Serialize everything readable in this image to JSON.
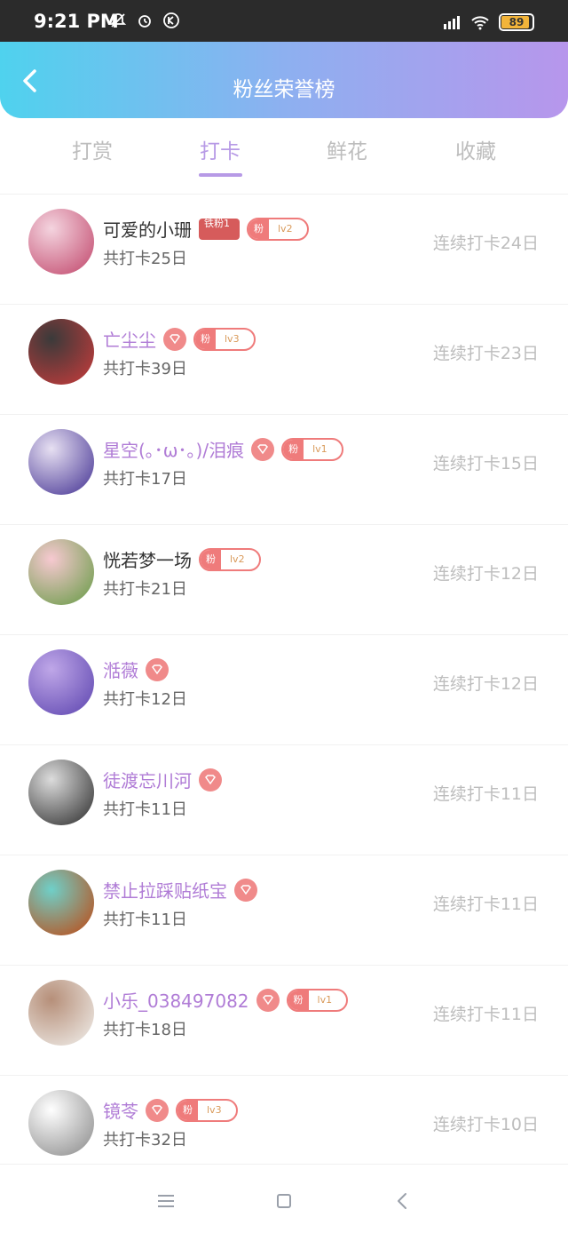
{
  "status": {
    "time": "9:21 PM",
    "battery": "89",
    "network_label": "HD"
  },
  "header": {
    "title": "粉丝荣誉榜"
  },
  "tabs": [
    {
      "label": "打赏",
      "active": false
    },
    {
      "label": "打卡",
      "active": true
    },
    {
      "label": "鲜花",
      "active": false
    },
    {
      "label": "收藏",
      "active": false
    }
  ],
  "rows": [
    {
      "name": "可爱的小珊",
      "name_vip": false,
      "tie_badge": "铁粉1",
      "fan_badge": {
        "left": "粉",
        "right": "lv2"
      },
      "diamond": false,
      "total": "共打卡25日",
      "streak": "连续打卡24日",
      "avatar_colors": [
        "#f4d4df",
        "#c85a7b"
      ]
    },
    {
      "name": "亡尘尘",
      "name_vip": true,
      "diamond": true,
      "fan_badge": {
        "left": "粉",
        "right": "lv3"
      },
      "total": "共打卡39日",
      "streak": "连续打卡23日",
      "avatar_colors": [
        "#3a3a3a",
        "#b63b3b"
      ]
    },
    {
      "name": "星空(｡･ω･｡)/泪痕",
      "name_vip": true,
      "diamond": true,
      "fan_badge": {
        "left": "粉",
        "right": "lv1"
      },
      "total": "共打卡17日",
      "streak": "连续打卡15日",
      "avatar_colors": [
        "#e7e0f2",
        "#5a4aa0"
      ]
    },
    {
      "name": "恍若梦一场",
      "name_vip": false,
      "diamond": false,
      "fan_badge": {
        "left": "粉",
        "right": "lv2"
      },
      "total": "共打卡21日",
      "streak": "连续打卡12日",
      "avatar_colors": [
        "#f7c9d1",
        "#79a157"
      ]
    },
    {
      "name": "湉薇",
      "name_vip": true,
      "diamond": true,
      "total": "共打卡12日",
      "streak": "连续打卡12日",
      "avatar_colors": [
        "#bfa7e8",
        "#6a52b7"
      ]
    },
    {
      "name": "徒渡忘川河",
      "name_vip": true,
      "diamond": true,
      "total": "共打卡11日",
      "streak": "连续打卡11日",
      "avatar_colors": [
        "#dcdcdc",
        "#444444"
      ]
    },
    {
      "name": "禁止拉踩贴纸宝",
      "name_vip": true,
      "diamond": true,
      "total": "共打卡11日",
      "streak": "连续打卡11日",
      "avatar_colors": [
        "#6fd0c9",
        "#b45a2a"
      ]
    },
    {
      "name": "小乐_038497082",
      "name_vip": true,
      "diamond": true,
      "fan_badge": {
        "left": "粉",
        "right": "lv1"
      },
      "total": "共打卡18日",
      "streak": "连续打卡11日",
      "avatar_colors": [
        "#b68f79",
        "#e9e2dc"
      ]
    },
    {
      "name": "镜苓",
      "name_vip": true,
      "diamond": true,
      "fan_badge": {
        "left": "粉",
        "right": "lv3"
      },
      "total": "共打卡32日",
      "streak": "连续打卡10日",
      "avatar_colors": [
        "#ffffff",
        "#999999"
      ]
    }
  ]
}
